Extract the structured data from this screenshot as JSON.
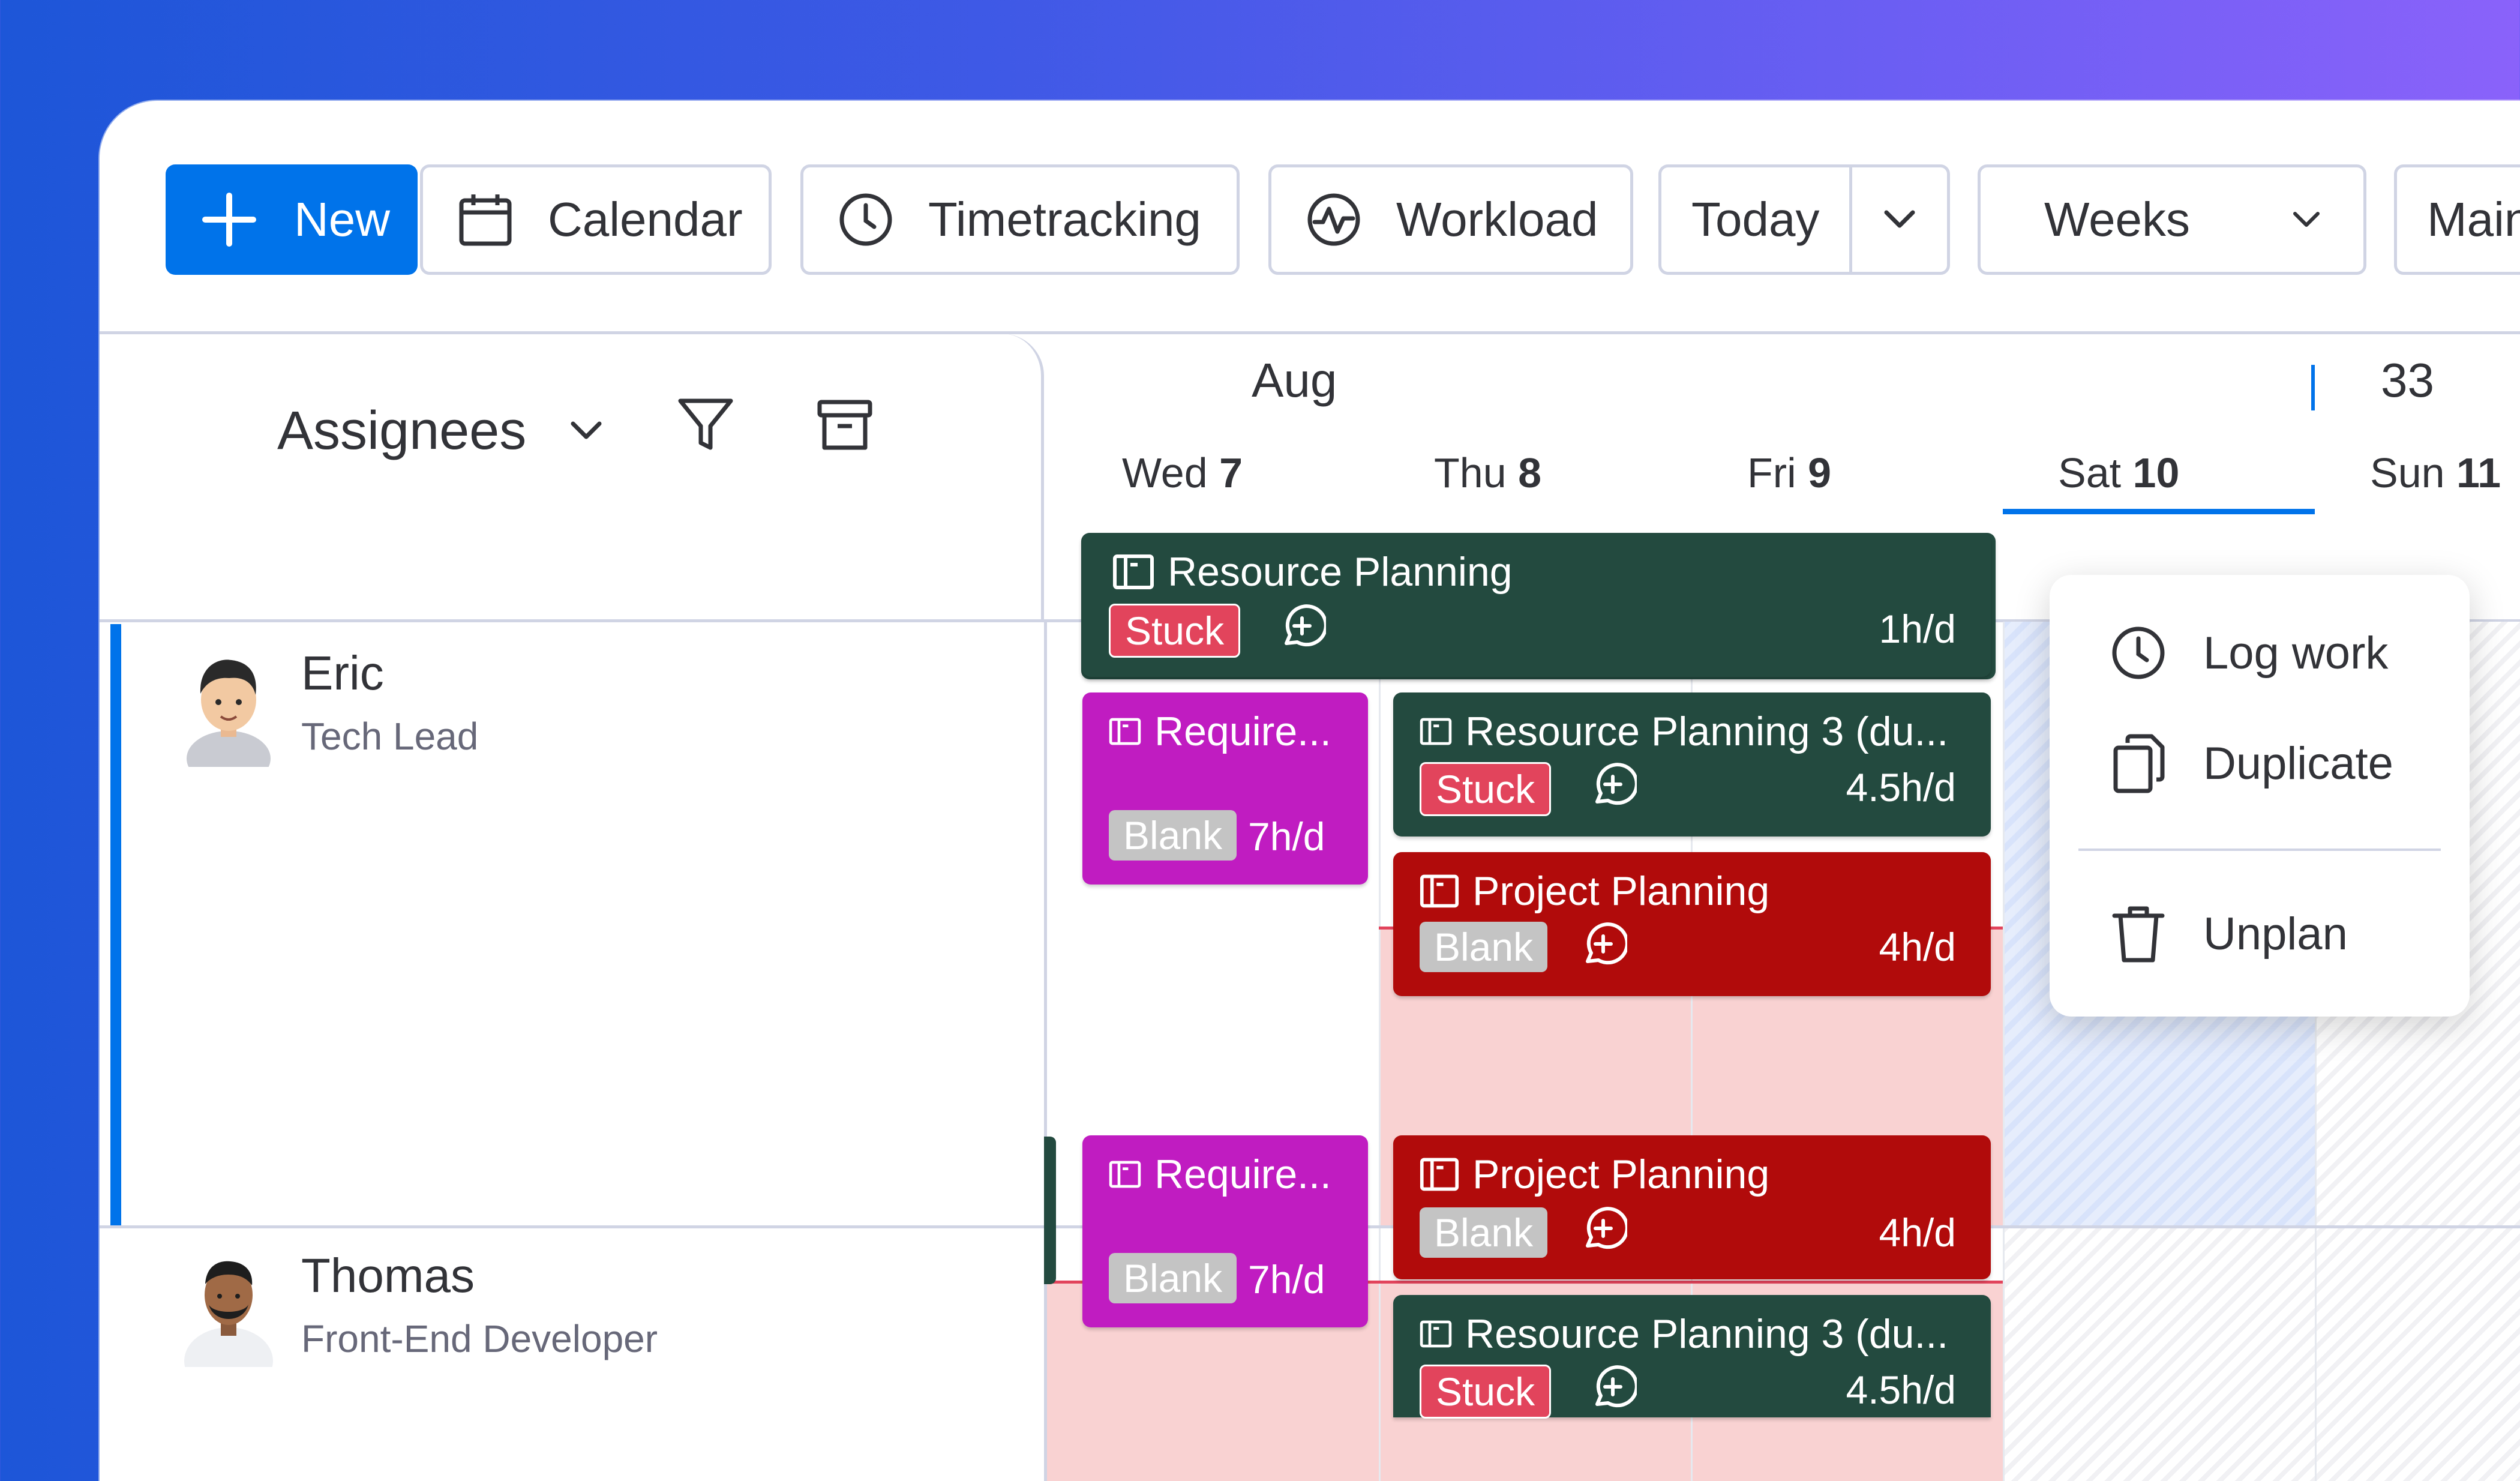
{
  "toolbar": {
    "new_label": "New",
    "calendar_label": "Calendar",
    "timetracking_label": "Timetracking",
    "workload_label": "Workload",
    "today_label": "Today",
    "weeks_label": "Weeks",
    "main_label": "Main"
  },
  "sidebar_header": {
    "assignees_label": "Assignees"
  },
  "calendar": {
    "month": "Aug",
    "week_number": "33",
    "days": [
      {
        "name": "Wed",
        "num": "7"
      },
      {
        "name": "Thu",
        "num": "8"
      },
      {
        "name": "Fri",
        "num": "9"
      },
      {
        "name": "Sat",
        "num": "10"
      },
      {
        "name": "Sun",
        "num": "11"
      }
    ]
  },
  "people": [
    {
      "name": "Eric",
      "role": "Tech Lead"
    },
    {
      "name": "Thomas",
      "role": "Front-End Developer"
    }
  ],
  "cards": {
    "eric_resource_planning": {
      "title": "Resource Planning",
      "status": "Stuck",
      "hours": "1h/d"
    },
    "eric_require": {
      "title": "Require...",
      "status": "Blank",
      "hours": "7h/d"
    },
    "eric_resource_planning_3": {
      "title": "Resource Planning 3 (du...",
      "status": "Stuck",
      "hours": "4.5h/d"
    },
    "eric_project_planning": {
      "title": "Project Planning",
      "status": "Blank",
      "hours": "4h/d"
    },
    "thomas_require": {
      "title": "Require...",
      "status": "Blank",
      "hours": "7h/d"
    },
    "thomas_project_planning": {
      "title": "Project Planning",
      "status": "Blank",
      "hours": "4h/d"
    },
    "thomas_resource_planning_3": {
      "title": "Resource Planning 3 (du...",
      "status": "Stuck",
      "hours": "4.5h/d"
    }
  },
  "context_menu": {
    "log_work": "Log work",
    "duplicate": "Duplicate",
    "unplan": "Unplan"
  },
  "colors": {
    "primary": "#0073ea",
    "card_green": "#234a3f",
    "card_magenta": "#c01cc1",
    "card_red": "#b10b0b",
    "status_stuck": "#e2445c",
    "status_blank": "#c4c4c4"
  }
}
